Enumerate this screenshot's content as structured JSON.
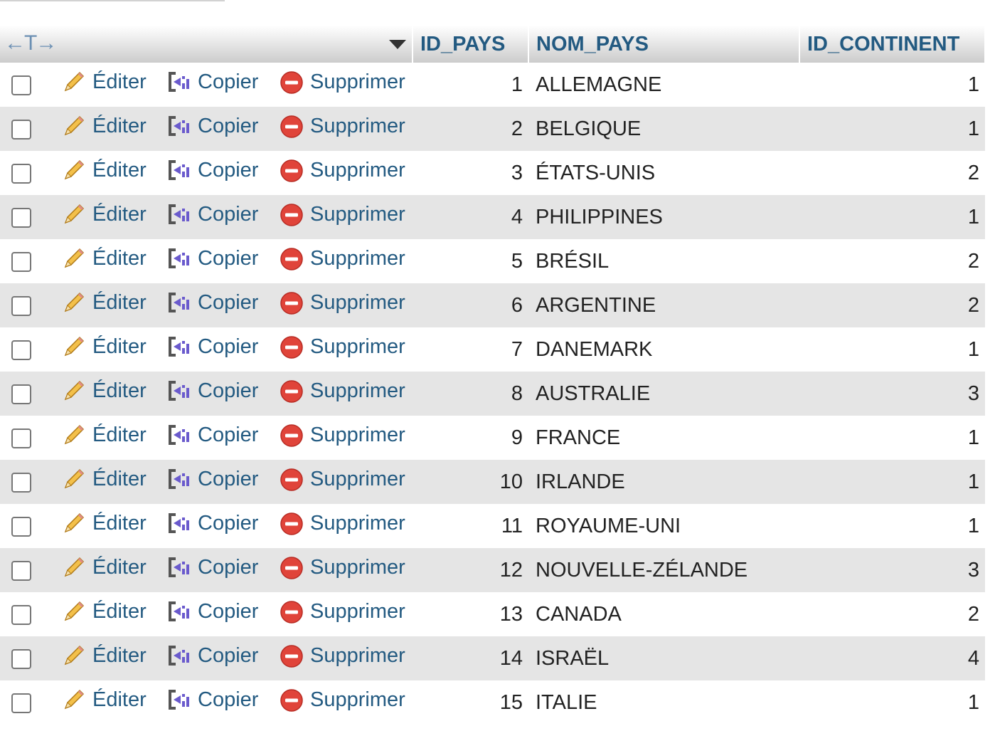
{
  "header": {
    "columns": [
      "ID_PAYS",
      "NOM_PAYS",
      "ID_CONTINENT"
    ],
    "arrows": "←T→"
  },
  "actions": {
    "edit": "Éditer",
    "copy": "Copier",
    "delete": "Supprimer"
  },
  "rows": [
    {
      "id": "1",
      "nom": "ALLEMAGNE",
      "continent": "1"
    },
    {
      "id": "2",
      "nom": "BELGIQUE",
      "continent": "1"
    },
    {
      "id": "3",
      "nom": "ÉTATS-UNIS",
      "continent": "2"
    },
    {
      "id": "4",
      "nom": "PHILIPPINES",
      "continent": "1"
    },
    {
      "id": "5",
      "nom": "BRÉSIL",
      "continent": "2"
    },
    {
      "id": "6",
      "nom": "ARGENTINE",
      "continent": "2"
    },
    {
      "id": "7",
      "nom": "DANEMARK",
      "continent": "1"
    },
    {
      "id": "8",
      "nom": "AUSTRALIE",
      "continent": "3"
    },
    {
      "id": "9",
      "nom": "FRANCE",
      "continent": "1"
    },
    {
      "id": "10",
      "nom": "IRLANDE",
      "continent": "1"
    },
    {
      "id": "11",
      "nom": "ROYAUME-UNI",
      "continent": "1"
    },
    {
      "id": "12",
      "nom": "NOUVELLE-ZÉLANDE",
      "continent": "3"
    },
    {
      "id": "13",
      "nom": "CANADA",
      "continent": "2"
    },
    {
      "id": "14",
      "nom": "ISRAËL",
      "continent": "4"
    },
    {
      "id": "15",
      "nom": "ITALIE",
      "continent": "1"
    }
  ],
  "colors": {
    "link": "#235a81",
    "row_alt": "#e5e5e5",
    "delete_icon": "#e0443a",
    "copy_icon": "#6a5acd",
    "edit_icon": "#f0b040"
  },
  "icons": {
    "edit": "pencil-icon",
    "copy": "copy-icon",
    "delete": "delete-circle-icon",
    "sort": "sort-down-icon"
  }
}
